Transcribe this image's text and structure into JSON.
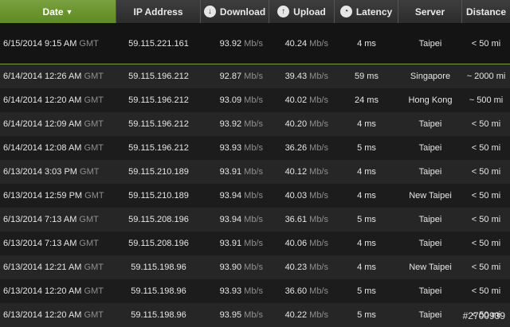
{
  "columns": [
    {
      "key": "date",
      "label": "Date",
      "sort": "▼",
      "icon": "",
      "active": true
    },
    {
      "key": "ip",
      "label": "IP Address",
      "icon": ""
    },
    {
      "key": "download",
      "label": "Download",
      "icon": "download-icon",
      "glyph": "↓"
    },
    {
      "key": "upload",
      "label": "Upload",
      "icon": "upload-icon",
      "glyph": "↑"
    },
    {
      "key": "latency",
      "label": "Latency",
      "icon": "gauge-icon",
      "glyph": "◔"
    },
    {
      "key": "server",
      "label": "Server",
      "icon": ""
    },
    {
      "key": "distance",
      "label": "Distance",
      "icon": ""
    }
  ],
  "speed_unit": "Mb/s",
  "rows": [
    {
      "date": "6/15/2014 9:15 AM",
      "tz": "GMT",
      "ip": "59.115.221.161",
      "download": "93.92",
      "upload": "40.24",
      "latency": "4 ms",
      "server": "Taipei",
      "distance": "< 50 mi",
      "latest": true
    },
    {
      "date": "6/14/2014 12:26 AM",
      "tz": "GMT",
      "ip": "59.115.196.212",
      "download": "92.87",
      "upload": "39.43",
      "latency": "59 ms",
      "server": "Singapore",
      "distance": "~ 2000 mi"
    },
    {
      "date": "6/14/2014 12:20 AM",
      "tz": "GMT",
      "ip": "59.115.196.212",
      "download": "93.09",
      "upload": "40.02",
      "latency": "24 ms",
      "server": "Hong Kong",
      "distance": "~ 500 mi"
    },
    {
      "date": "6/14/2014 12:09 AM",
      "tz": "GMT",
      "ip": "59.115.196.212",
      "download": "93.92",
      "upload": "40.20",
      "latency": "4 ms",
      "server": "Taipei",
      "distance": "< 50 mi"
    },
    {
      "date": "6/14/2014 12:08 AM",
      "tz": "GMT",
      "ip": "59.115.196.212",
      "download": "93.93",
      "upload": "36.26",
      "latency": "5 ms",
      "server": "Taipei",
      "distance": "< 50 mi"
    },
    {
      "date": "6/13/2014 3:03 PM",
      "tz": "GMT",
      "ip": "59.115.210.189",
      "download": "93.91",
      "upload": "40.12",
      "latency": "4 ms",
      "server": "Taipei",
      "distance": "< 50 mi"
    },
    {
      "date": "6/13/2014 12:59 PM",
      "tz": "GMT",
      "ip": "59.115.210.189",
      "download": "93.94",
      "upload": "40.03",
      "latency": "4 ms",
      "server": "New Taipei",
      "distance": "< 50 mi"
    },
    {
      "date": "6/13/2014 7:13 AM",
      "tz": "GMT",
      "ip": "59.115.208.196",
      "download": "93.94",
      "upload": "36.61",
      "latency": "5 ms",
      "server": "Taipei",
      "distance": "< 50 mi"
    },
    {
      "date": "6/13/2014 7:13 AM",
      "tz": "GMT",
      "ip": "59.115.208.196",
      "download": "93.91",
      "upload": "40.06",
      "latency": "4 ms",
      "server": "Taipei",
      "distance": "< 50 mi"
    },
    {
      "date": "6/13/2014 12:21 AM",
      "tz": "GMT",
      "ip": "59.115.198.96",
      "download": "93.90",
      "upload": "40.23",
      "latency": "4 ms",
      "server": "New Taipei",
      "distance": "< 50 mi"
    },
    {
      "date": "6/13/2014 12:20 AM",
      "tz": "GMT",
      "ip": "59.115.198.96",
      "download": "93.93",
      "upload": "36.60",
      "latency": "5 ms",
      "server": "Taipei",
      "distance": "< 50 mi"
    },
    {
      "date": "6/13/2014 12:20 AM",
      "tz": "GMT",
      "ip": "59.115.198.96",
      "download": "93.95",
      "upload": "40.22",
      "latency": "5 ms",
      "server": "Taipei",
      "distance": "< 50 mi"
    }
  ],
  "watermark": "#2700939",
  "colors": {
    "accent": "#6b9a2e",
    "background": "#1a1a1a",
    "unit_text": "#8f8f8f"
  }
}
